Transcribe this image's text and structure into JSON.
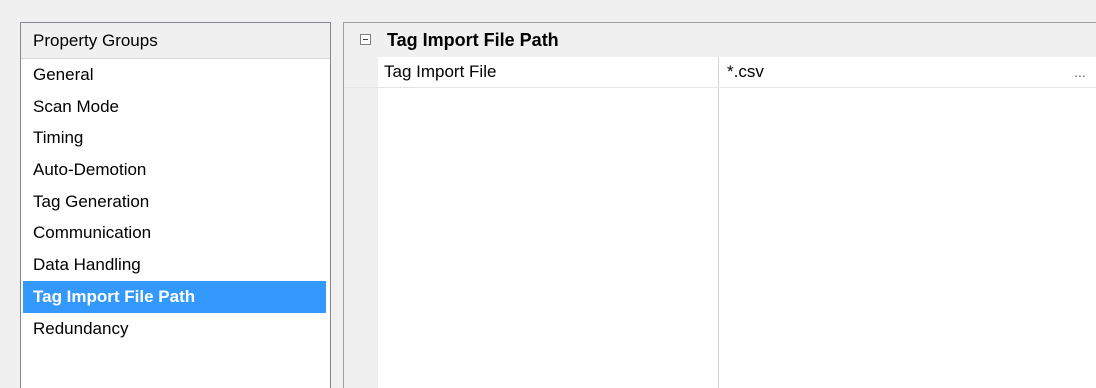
{
  "property_groups": {
    "header": "Property Groups",
    "items": [
      {
        "label": "General",
        "selected": false
      },
      {
        "label": "Scan Mode",
        "selected": false
      },
      {
        "label": "Timing",
        "selected": false
      },
      {
        "label": "Auto-Demotion",
        "selected": false
      },
      {
        "label": "Tag Generation",
        "selected": false
      },
      {
        "label": "Communication",
        "selected": false
      },
      {
        "label": "Data Handling",
        "selected": false
      },
      {
        "label": "Tag Import File Path",
        "selected": true
      },
      {
        "label": "Redundancy",
        "selected": false
      }
    ]
  },
  "property_grid": {
    "section_title": "Tag Import File Path",
    "collapse_icon": "minus-box-icon",
    "rows": [
      {
        "name": "Tag Import File",
        "value": "*.csv",
        "button_label": "..."
      }
    ]
  },
  "colors": {
    "selection": "#3399ff",
    "selection_text": "#ffffff",
    "panel_bg": "#f0f0f0"
  }
}
